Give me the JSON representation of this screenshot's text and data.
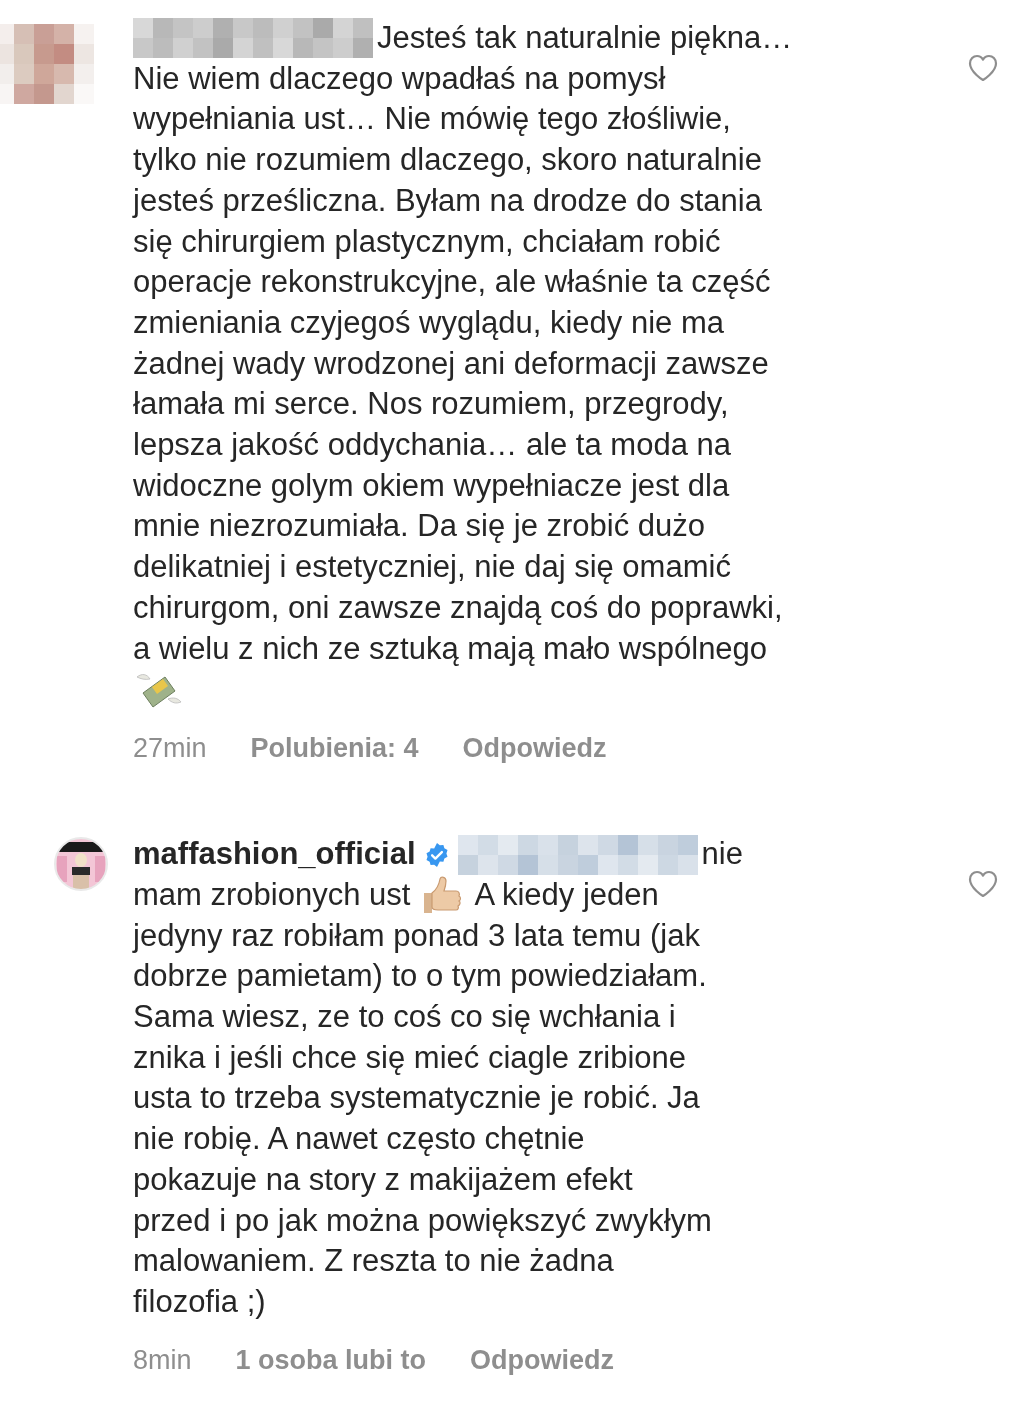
{
  "comments": [
    {
      "avatar": {
        "kind": "blurred"
      },
      "lines": [
        [
          {
            "kind": "redacted"
          },
          {
            "kind": "text",
            "text": "Jesteś tak naturalnie piękna…"
          }
        ],
        [
          {
            "kind": "text",
            "text": "Nie wiem dlaczego wpadłaś na pomysł\nwypełniania ust… Nie mówię tego złośliwie,\ntylko nie rozumiem dlaczego, skoro naturalnie\njesteś prześliczna. Byłam na drodze do stania\nsię chirurgiem plastycznym, chciałam robić\noperacje rekonstrukcyjne, ale właśnie ta część\nzmieniania czyjegoś wyglądu, kiedy nie ma\nżadnej wady wrodzonej ani deformacji zawsze\nłamała mi serce. Nos rozumiem, przegrody,\nlepsza jakość oddychania… ale ta moda na\nwidoczne golym okiem wypełniacze jest dla\nmnie niezrozumiała. Da się je zrobić dużo\ndelikatniej i estetyczniej, nie daj się omamić\nchirurgom, oni zawsze znajdą coś do poprawki,\na wielu z nich ze sztuką mają mało wspólnego"
          }
        ],
        [
          {
            "kind": "money-emoji"
          }
        ]
      ],
      "time": "27min",
      "likes": "Polubienia: 4",
      "reply": "Odpowiedz"
    },
    {
      "avatar": {
        "kind": "picture"
      },
      "lines": [
        [
          {
            "kind": "username",
            "text": "maffashion_official"
          },
          {
            "kind": "verified"
          },
          {
            "kind": "redacted"
          },
          {
            "kind": "text",
            "text": "nie"
          }
        ],
        [
          {
            "kind": "text",
            "text": "mam zrobionych ust"
          },
          {
            "kind": "thumbs-emoji"
          },
          {
            "kind": "text",
            "text": "A kiedy jeden"
          }
        ],
        [
          {
            "kind": "text",
            "text": "jedyny raz robiłam ponad 3 lata temu (jak\ndobrze pamietam) to o tym powiedziałam.\nSama wiesz, ze to coś co się wchłania i\nznika i jeśli chce się mieć ciagle zribione\nusta to trzeba systematycznie je robić. Ja\nnie robię. A nawet często chętnie\npokazuje na story z makijażem efekt\nprzed i po jak można powiększyć zwykłym\nmalowaniem. Z reszta to nie żadna\nfilozofia ;)"
          }
        ]
      ],
      "time": "8min",
      "likes": "1 osoba lubi to",
      "reply": "Odpowiedz"
    }
  ]
}
